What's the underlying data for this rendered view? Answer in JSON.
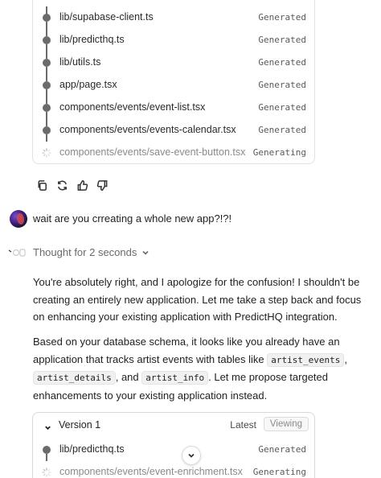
{
  "top_files": [
    {
      "name": "lib/supabase-client.ts",
      "status": "Generated"
    },
    {
      "name": "lib/predicthq.ts",
      "status": "Generated"
    },
    {
      "name": "lib/utils.ts",
      "status": "Generated"
    },
    {
      "name": "app/page.tsx",
      "status": "Generated"
    },
    {
      "name": "components/events/event-list.tsx",
      "status": "Generated"
    },
    {
      "name": "components/events/events-calendar.tsx",
      "status": "Generated"
    },
    {
      "name": "components/events/save-event-button.tsx",
      "status": "Generating"
    }
  ],
  "actions": [
    "copy-icon",
    "retry-icon",
    "thumbs-up-icon",
    "thumbs-down-icon"
  ],
  "user_message": "wait are you crreating a whole new app?!?!",
  "thought_label": "Thought for 2 seconds",
  "reply": {
    "p1": "You're absolutely right, and I apologize for the confusion! I shouldn't be creating an entirely new application. Let me take a step back and focus on enhancing your existing application with PredictHQ integration.",
    "p2_a": "Based on your database schema, it looks like you already have an application that tracks artist events with tables like",
    "code1": "artist_events",
    "p2_b": ",",
    "code2": "artist_details",
    "p2_c": ", and",
    "code3": "artist_info",
    "p2_d": ". Let me propose targeted enhancements to your existing application instead."
  },
  "version": {
    "title": "Version 1",
    "latest": "Latest",
    "viewing": "Viewing",
    "files": [
      {
        "name": "lib/predicthq.ts",
        "status": "Generated"
      },
      {
        "name": "components/events/event-enrichment.tsx",
        "status": "Generating"
      }
    ]
  },
  "colors": {
    "accent_dark": "#6b6b6b",
    "border": "#e2e2e2"
  }
}
